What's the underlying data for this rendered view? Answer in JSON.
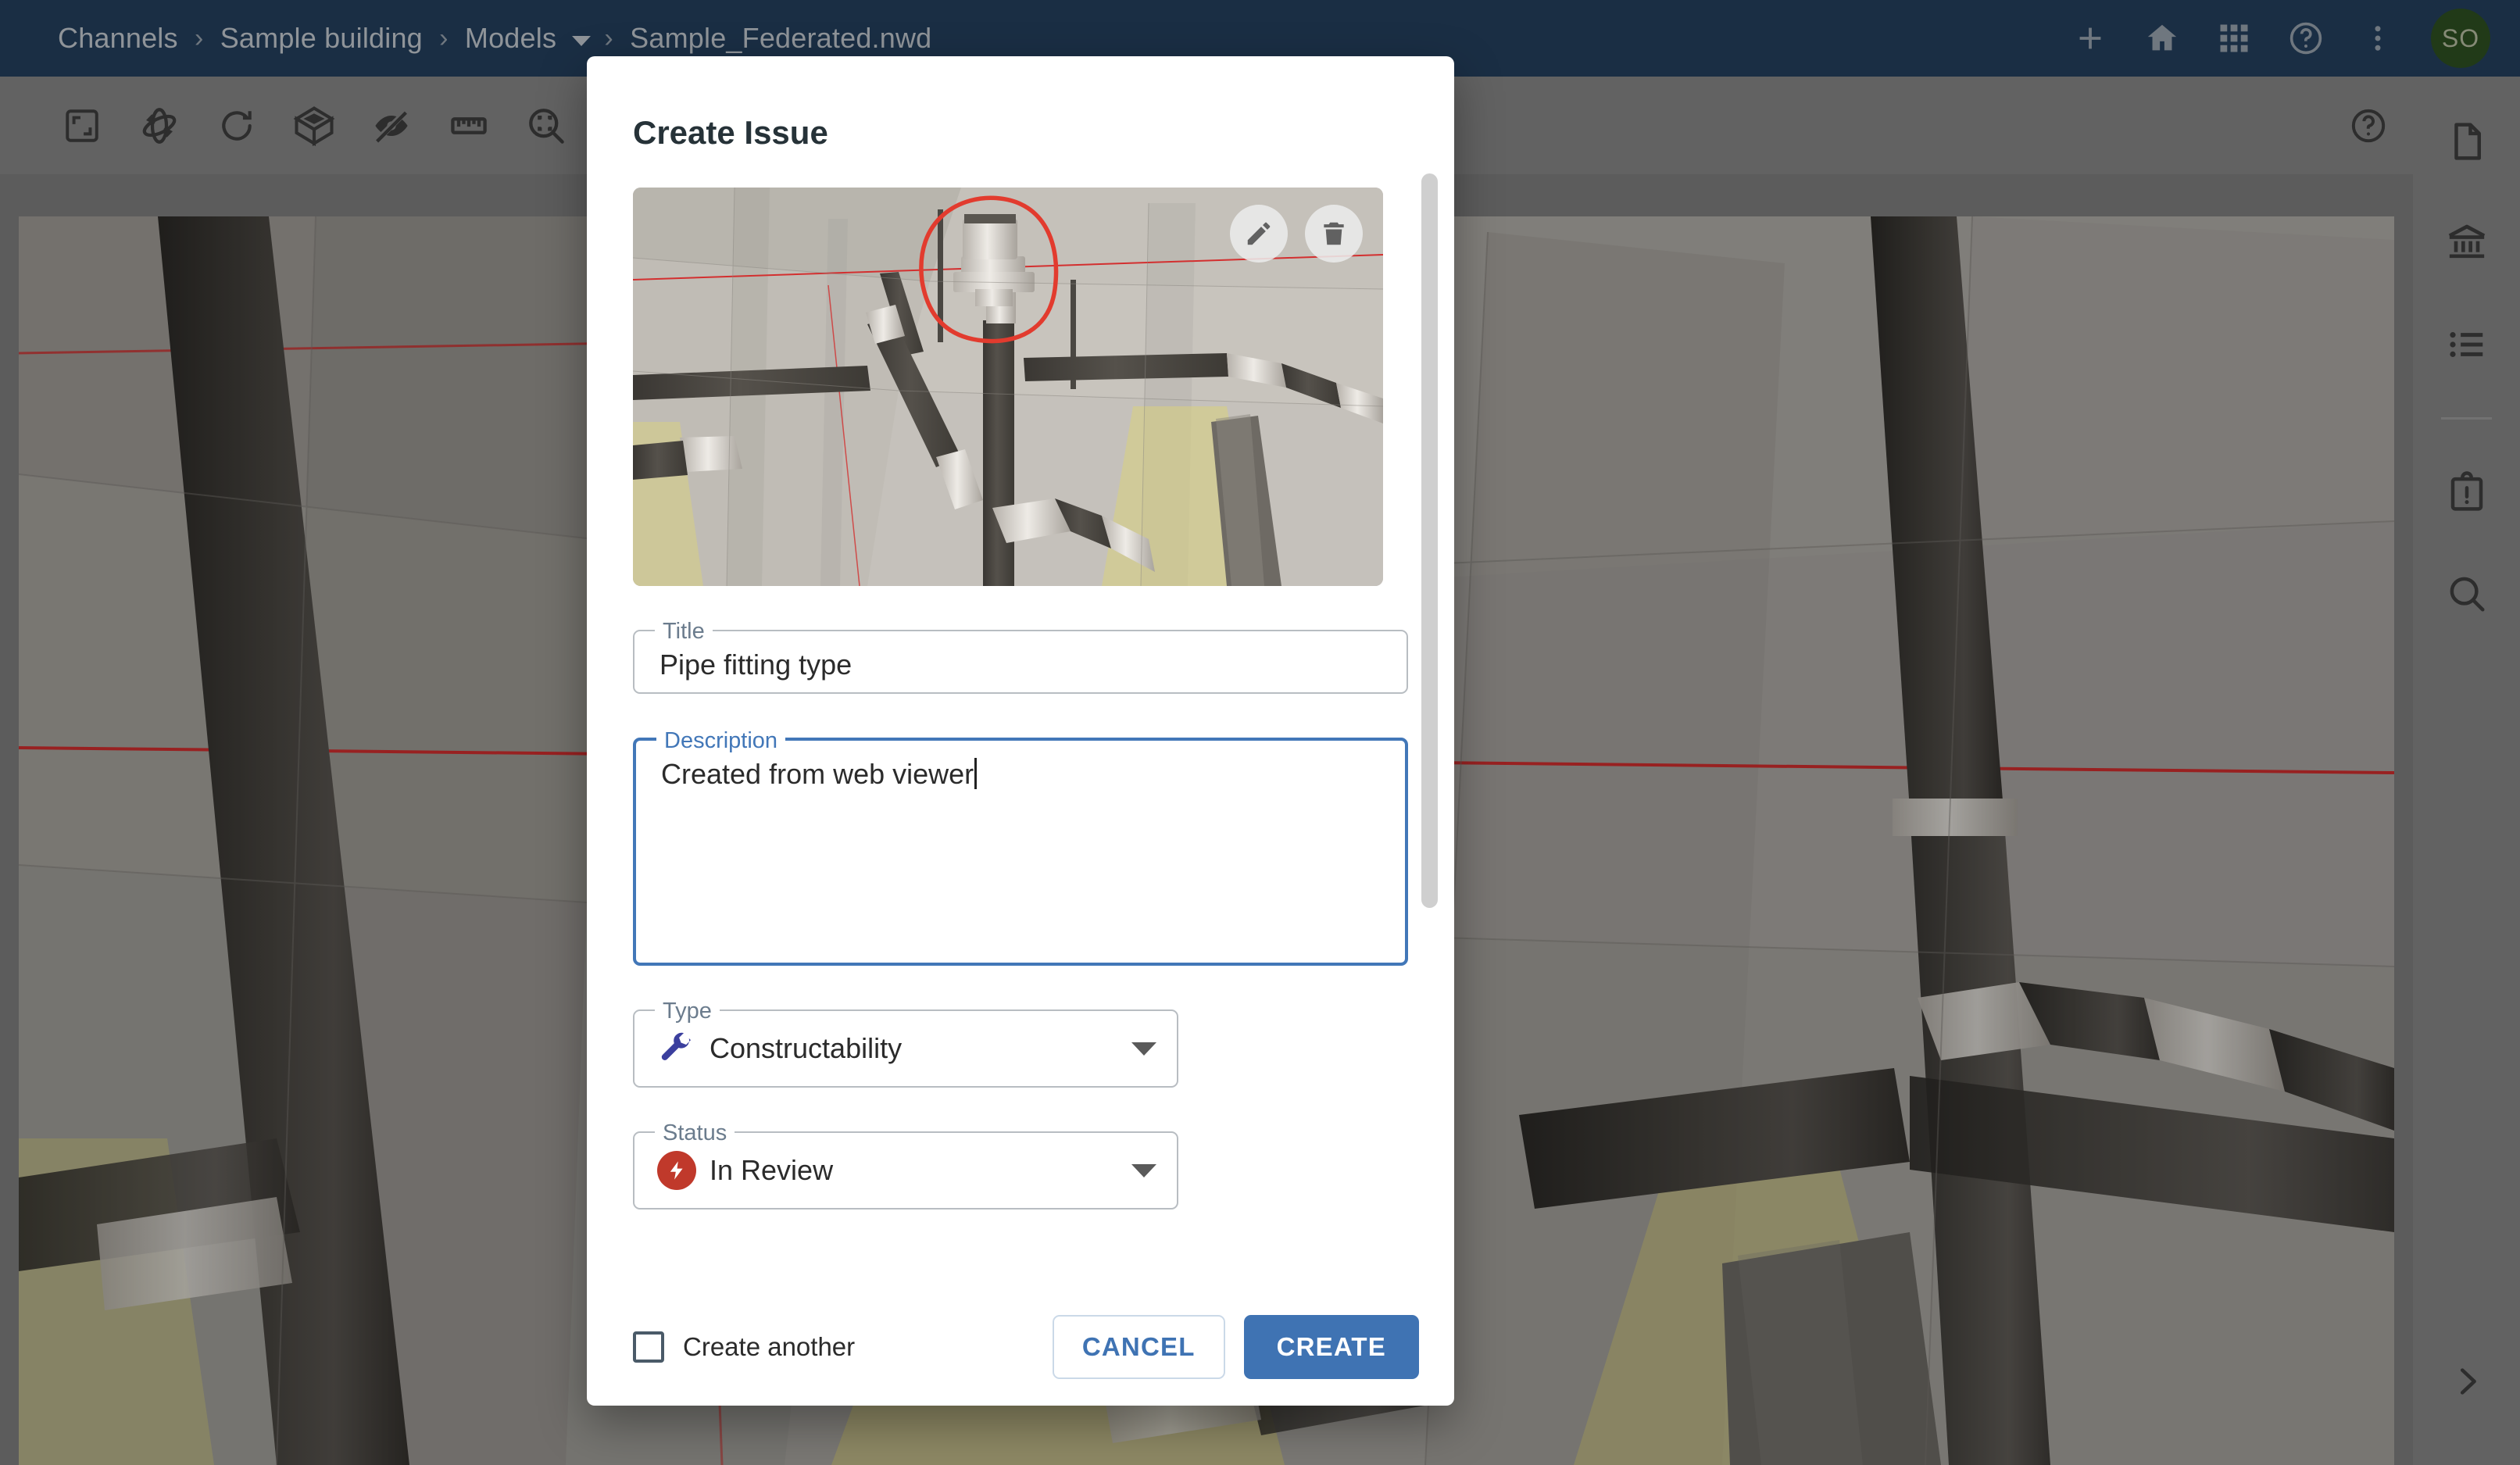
{
  "header": {
    "bg_color": "#25405f",
    "breadcrumb": [
      {
        "label": "Channels",
        "has_caret": false
      },
      {
        "label": "Sample building",
        "has_caret": false
      },
      {
        "label": "Models",
        "has_caret": true
      },
      {
        "label": "Sample_Federated.nwd",
        "has_caret": false
      }
    ],
    "separator": "›",
    "actions": [
      {
        "name": "add-icon",
        "title": "Add"
      },
      {
        "name": "home-icon",
        "title": "Home"
      },
      {
        "name": "apps-grid-icon",
        "title": "Apps"
      },
      {
        "name": "help-circle-icon",
        "title": "Help"
      },
      {
        "name": "more-vertical-icon",
        "title": "More"
      }
    ],
    "avatar": {
      "initials": "SO",
      "color": "#2f5122"
    }
  },
  "viewer_toolbar": {
    "bg_color": "#888888",
    "tools": [
      {
        "name": "fit-to-view-icon",
        "title": "Fit to view"
      },
      {
        "name": "orbit-icon",
        "title": "Orbit"
      },
      {
        "name": "reset-view-icon",
        "title": "Reset view"
      },
      {
        "name": "section-cube-icon",
        "title": "Section box"
      },
      {
        "name": "hide-eye-icon",
        "title": "Hide"
      },
      {
        "name": "measure-ruler-icon",
        "title": "Measure"
      },
      {
        "name": "zoom-window-icon",
        "title": "Zoom window"
      }
    ],
    "help": {
      "name": "help-circle-icon",
      "title": "Help"
    }
  },
  "right_rail": {
    "bg_color": "#888888",
    "items": [
      {
        "name": "document-icon",
        "title": "Document"
      },
      {
        "name": "building-icon",
        "title": "Model tree"
      },
      {
        "name": "list-icon",
        "title": "Properties"
      }
    ],
    "items_lower": [
      {
        "name": "issues-clipboard-icon",
        "title": "Issues"
      },
      {
        "name": "search-icon",
        "title": "Search"
      }
    ],
    "expand": {
      "name": "chevron-right-icon",
      "title": "Expand panel"
    }
  },
  "dialog": {
    "title": "Create Issue",
    "thumbnail": {
      "name": "issue-viewpoint-thumbnail",
      "markup_color": "#e23b2e",
      "actions": [
        {
          "name": "edit-markup-icon",
          "title": "Edit markup"
        },
        {
          "name": "delete-thumbnail-icon",
          "title": "Delete"
        }
      ]
    },
    "fields": {
      "title": {
        "label": "Title",
        "value": "Pipe fitting type",
        "placeholder": "Title",
        "focused": false
      },
      "description": {
        "label": "Description",
        "value": "Created from web viewer",
        "placeholder": "Description",
        "focused": true
      },
      "type": {
        "label": "Type",
        "value": "Constructability",
        "icon": "wrench-icon",
        "icon_color": "#3b3f9e"
      },
      "status": {
        "label": "Status",
        "value": "In Review",
        "icon": "lightning-bolt-icon",
        "icon_color": "#c0392b"
      }
    },
    "footer": {
      "create_another_label": "Create another",
      "create_another_checked": false,
      "cancel_label": "CANCEL",
      "create_label": "CREATE",
      "primary_color": "#3f73b3"
    }
  }
}
